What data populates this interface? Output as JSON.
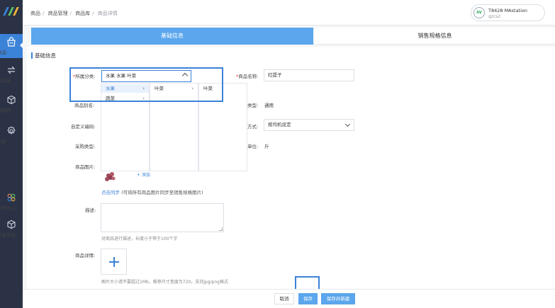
{
  "sidebar": {
    "items": [
      {
        "label": "商品",
        "icon": "bag-icon",
        "active": true
      },
      {
        "label": "供应链",
        "icon": "exchange-icon",
        "active": false
      },
      {
        "label": "进销存",
        "icon": "box-icon",
        "active": false
      },
      {
        "label": "系统",
        "icon": "gear-icon",
        "active": false
      },
      {
        "label": "应用中心",
        "icon": "apps-icon",
        "active": false
      },
      {
        "label": "信息平台",
        "icon": "cube-icon",
        "active": false
      }
    ],
    "accent_color": "#3b82d9"
  },
  "breadcrumb": [
    "商品",
    "商品管理",
    "商品库",
    "商品详情"
  ],
  "user": {
    "avatar_text": "AV",
    "name": "T8428 MAstation",
    "sub": "qzcs2"
  },
  "tabs": [
    {
      "label": "基础信息",
      "active": true
    },
    {
      "label": "销售规格信息",
      "active": false
    }
  ],
  "section_title": "基础信息",
  "form": {
    "category_label": "所属分类:",
    "category_value": "水果 水果 叶菜",
    "cascader": {
      "col1": [
        {
          "label": "水果",
          "selected": true,
          "has_children": true
        },
        {
          "label": "蔬菜",
          "selected": false,
          "has_children": true
        }
      ],
      "col2": [
        {
          "label": "叶菜",
          "selected": false,
          "has_children": true
        }
      ],
      "col3": [
        {
          "label": "叶菜",
          "selected": false,
          "has_children": false
        }
      ]
    },
    "name_label": "商品名称:",
    "name_value": "红提子",
    "alias_label": "商品别名:",
    "type_label": "类型:",
    "type_value": "通用",
    "custom_code_label": "自定义编码:",
    "method_label": "方式:",
    "method_value": "按司机设定",
    "purchase_type_label": "采购类型:",
    "unit_label": "单位:",
    "unit_value": "斤",
    "image_label": "商品图片:",
    "image_add": "+ 添加",
    "sync_link": "点击同步",
    "sync_text": "(可将所有商品图片同步至销售规格图片)",
    "desc_label": "描述:",
    "desc_hint": "对商品进行描述，长度小于等于100个字",
    "detail_label": "商品详情:",
    "detail_hint": "图片大小请不要超过1Mb，推荐尺寸宽度为720，支持jpg/png格式"
  },
  "footer": {
    "cancel": "取消",
    "save": "保存",
    "save_new": "保存并新建"
  }
}
